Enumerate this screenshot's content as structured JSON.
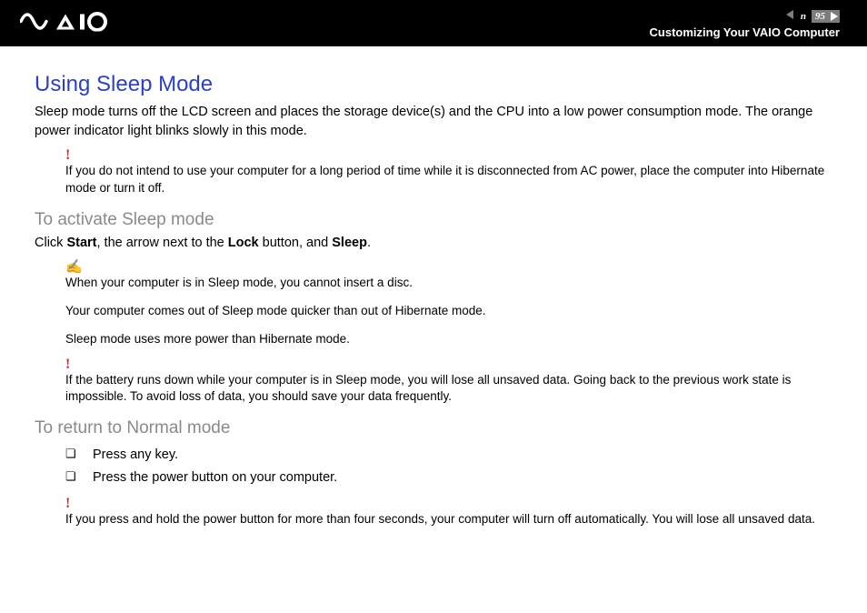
{
  "header": {
    "page_number": "95",
    "nav_letter": "n",
    "section": "Customizing Your VAIO Computer"
  },
  "title": "Using Sleep Mode",
  "intro": "Sleep mode turns off the LCD screen and places the storage device(s) and the CPU into a low power consumption mode. The orange power indicator light blinks slowly in this mode.",
  "warning1": "If you do not intend to use your computer for a long period of time while it is disconnected from AC power, place the computer into Hibernate mode or turn it off.",
  "sub_activate": "To activate Sleep mode",
  "activate_text": {
    "p1": "Click ",
    "b1": "Start",
    "p2": ", the arrow next to the ",
    "b2": "Lock",
    "p3": " button, and ",
    "b3": "Sleep",
    "p4": "."
  },
  "info_notes": [
    "When your computer is in Sleep mode, you cannot insert a disc.",
    "Your computer comes out of Sleep mode quicker than out of Hibernate mode.",
    "Sleep mode uses more power than Hibernate mode."
  ],
  "warning2": "If the battery runs down while your computer is in Sleep mode, you will lose all unsaved data. Going back to the previous work state is impossible. To avoid loss of data, you should save your data frequently.",
  "sub_return": "To return to Normal mode",
  "return_list": [
    "Press any key.",
    "Press the power button on your computer."
  ],
  "warning3": "If you press and hold the power button for more than four seconds, your computer will turn off automatically. You will lose all unsaved data.",
  "icons": {
    "warning": "!",
    "info": "✍"
  }
}
